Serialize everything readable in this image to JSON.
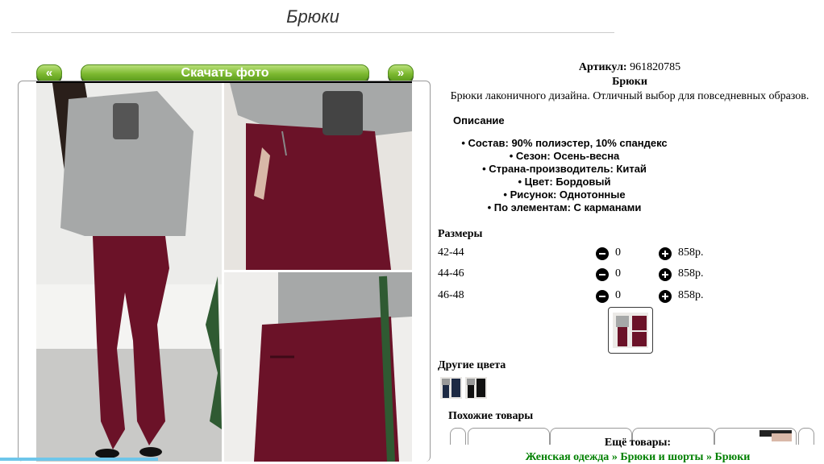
{
  "page": {
    "title": "Брюки"
  },
  "gallery": {
    "prev_label": "«",
    "download_label": "Скачать фото",
    "next_label": "»"
  },
  "product": {
    "article_label": "Артикул:",
    "article_value": "961820785",
    "name": "Брюки",
    "tagline": "Брюки лаконичного дизайна. Отличный выбор для повседневных образов."
  },
  "description": {
    "heading": "Описание",
    "items": [
      "Состав: 90% полиэстер, 10% спандекс",
      "Сезон: Осень-весна",
      "Страна-производитель: Китай",
      "Цвет: Бордовый",
      "Рисунок: Однотонные",
      "По элементам: С карманами"
    ]
  },
  "sizes": {
    "heading": "Размеры",
    "rows": [
      {
        "size": "42-44",
        "qty": "0",
        "price": "858р."
      },
      {
        "size": "44-46",
        "qty": "0",
        "price": "858р."
      },
      {
        "size": "46-48",
        "qty": "0",
        "price": "858р."
      }
    ]
  },
  "other_colors": {
    "heading": "Другие цвета"
  },
  "similar": {
    "heading": "Похожие товары"
  },
  "more": {
    "heading": "Ещё товары:",
    "crumbs": [
      "Женская одежда",
      "Брюки и шорты",
      "Брюки"
    ],
    "separator": "»"
  },
  "colors": {
    "accent_green": "#7cb82f",
    "trousers": "#6b1228",
    "sweater": "#a6a8a8",
    "link": "#008000"
  }
}
